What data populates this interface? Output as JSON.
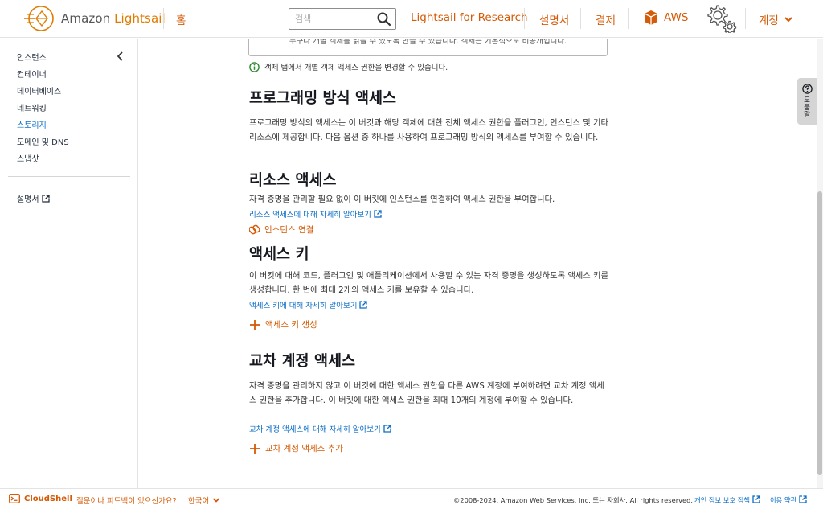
{
  "header": {
    "logo_prefix": "Amazon ",
    "logo_brand": "Lightsail",
    "home": "홈",
    "search_placeholder": "검색",
    "research": "Lightsail for Research",
    "docs": "설명서",
    "billing": "결제",
    "aws": "AWS",
    "account": "계정"
  },
  "sidebar": {
    "items": [
      "인스턴스",
      "컨테이너",
      "데이터베이스",
      "네트워킹",
      "스토리지",
      "도메인 및 DNS",
      "스냅샷"
    ],
    "active_index": 4,
    "docs_link": "설명서"
  },
  "main": {
    "notice_text": "누구나 개별 객체를 읽을 수 있도록 만들 수 있습니다. 객체는 기본적으로 비공개입니다.",
    "info_text": "객체 탭에서 개별 객체 액세스 권한을 변경할 수 있습니다.",
    "programmatic": {
      "title": "프로그래밍 방식 액세스",
      "desc": "프로그래밍 방식의 액세스는 이 버킷과 해당 객체에 대한 전체 액세스 권한을 플러그인, 인스턴스 및 기타 리소스에 제공합니다. 다음 옵션 중 하나를 사용하여 프로그래밍 방식의 액세스를 부여할 수 있습니다."
    },
    "resource": {
      "title": "리소스 액세스",
      "desc": "자격 증명을 관리할 필요 없이 이 버킷에 인스턴스를 연결하여 액세스 권한을 부여합니다.",
      "learn": "리소스 액세스에 대해 자세히 알아보기",
      "action": "인스턴스 연결"
    },
    "keys": {
      "title": "액세스 키",
      "desc": "이 버킷에 대해 코드, 플러그인 및 애플리케이션에서 사용할 수 있는 자격 증명을 생성하도록 액세스 키를 생성합니다. 한 번에 최대 2개의 액세스 키를 보유할 수 있습니다.",
      "learn": "액세스 키에 대해 자세히 알아보기",
      "action": "액세스 키 생성"
    },
    "cross": {
      "title": "교차 계정 액세스",
      "desc": "자격 증명을 관리하지 않고 이 버킷에 대한 액세스 권한을 다른 AWS 계정에 부여하려면 교차 계정 액세스 권한을 추가합니다. 이 버킷에 대한 액세스 권한을 최대 10개의 계정에 부여할 수 있습니다.",
      "learn": "교차 계정 액세스에 대해 자세히 알아보기",
      "action": "교차 계정 액세스 추가"
    }
  },
  "help_tab": "도움말",
  "footer": {
    "cloudshell": "CloudShell",
    "feedback": "질문이나 피드백이 있으신가요?",
    "language": "한국어",
    "copyright": "©2008-2024, Amazon Web Services, Inc. 또는 자회사. All rights reserved.",
    "privacy": "개인 정보 보호 정책",
    "terms": "이용 약관"
  },
  "colors": {
    "accent_orange": "#d45b07",
    "link_blue": "#0a6cc5",
    "text_dark": "#16191f"
  }
}
